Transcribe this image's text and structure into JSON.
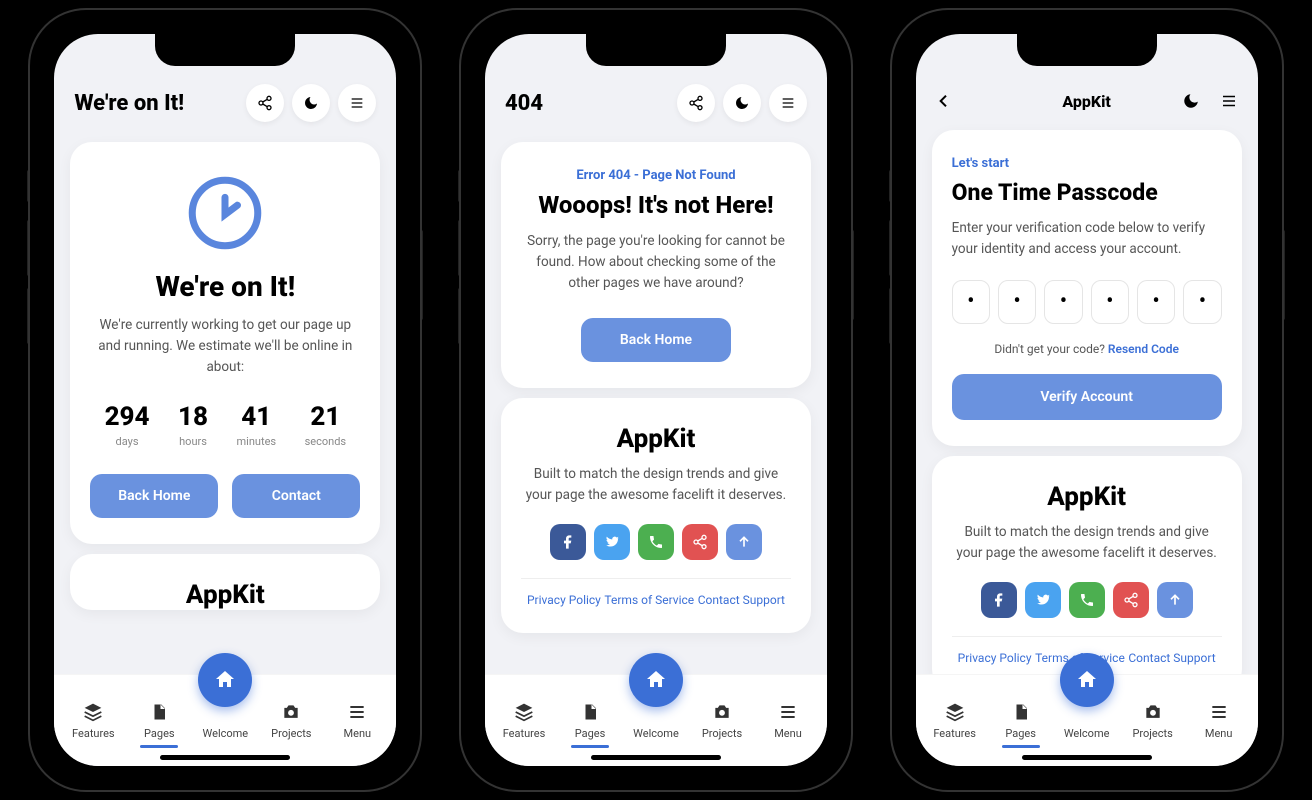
{
  "screen1": {
    "header_title": "We're on It!",
    "card": {
      "title": "We're on It!",
      "desc": "We're currently working to get our page up and running. We estimate we'll be online in about:",
      "countdown": {
        "days": "294",
        "days_lbl": "days",
        "hours": "18",
        "hours_lbl": "hours",
        "minutes": "41",
        "minutes_lbl": "minutes",
        "seconds": "21",
        "seconds_lbl": "seconds"
      },
      "btn_home": "Back Home",
      "btn_contact": "Contact"
    },
    "appkit_title": "AppKit"
  },
  "screen2": {
    "header_title": "404",
    "card": {
      "subheading": "Error 404 - Page Not Found",
      "title": "Wooops! It's not Here!",
      "desc": "Sorry, the page you're looking for cannot be found. How about checking some of the other pages we have around?",
      "btn": "Back Home"
    },
    "appkit": {
      "title": "AppKit",
      "desc": "Built to match the design trends and give your page the awesome facelift it deserves."
    },
    "links": {
      "privacy": "Privacy Policy",
      "terms": "Terms of Service",
      "contact": "Contact Support"
    }
  },
  "screen3": {
    "header_title": "AppKit",
    "card": {
      "subheading": "Let's start",
      "title": "One Time Passcode",
      "desc": "Enter your verification code below to verify your identity and access your account.",
      "otp": [
        "•",
        "•",
        "•",
        "•",
        "•",
        "•"
      ],
      "resend_prompt": "Didn't get your code? ",
      "resend_link": "Resend Code",
      "verify": "Verify Account"
    },
    "appkit": {
      "title": "AppKit",
      "desc": "Built to match the design trends and give your page the awesome facelift it deserves."
    },
    "links": {
      "privacy": "Privacy Policy",
      "terms": "Terms of Service",
      "contact": "Contact Support"
    }
  },
  "tabs": {
    "features": "Features",
    "pages": "Pages",
    "welcome": "Welcome",
    "projects": "Projects",
    "menu": "Menu"
  }
}
